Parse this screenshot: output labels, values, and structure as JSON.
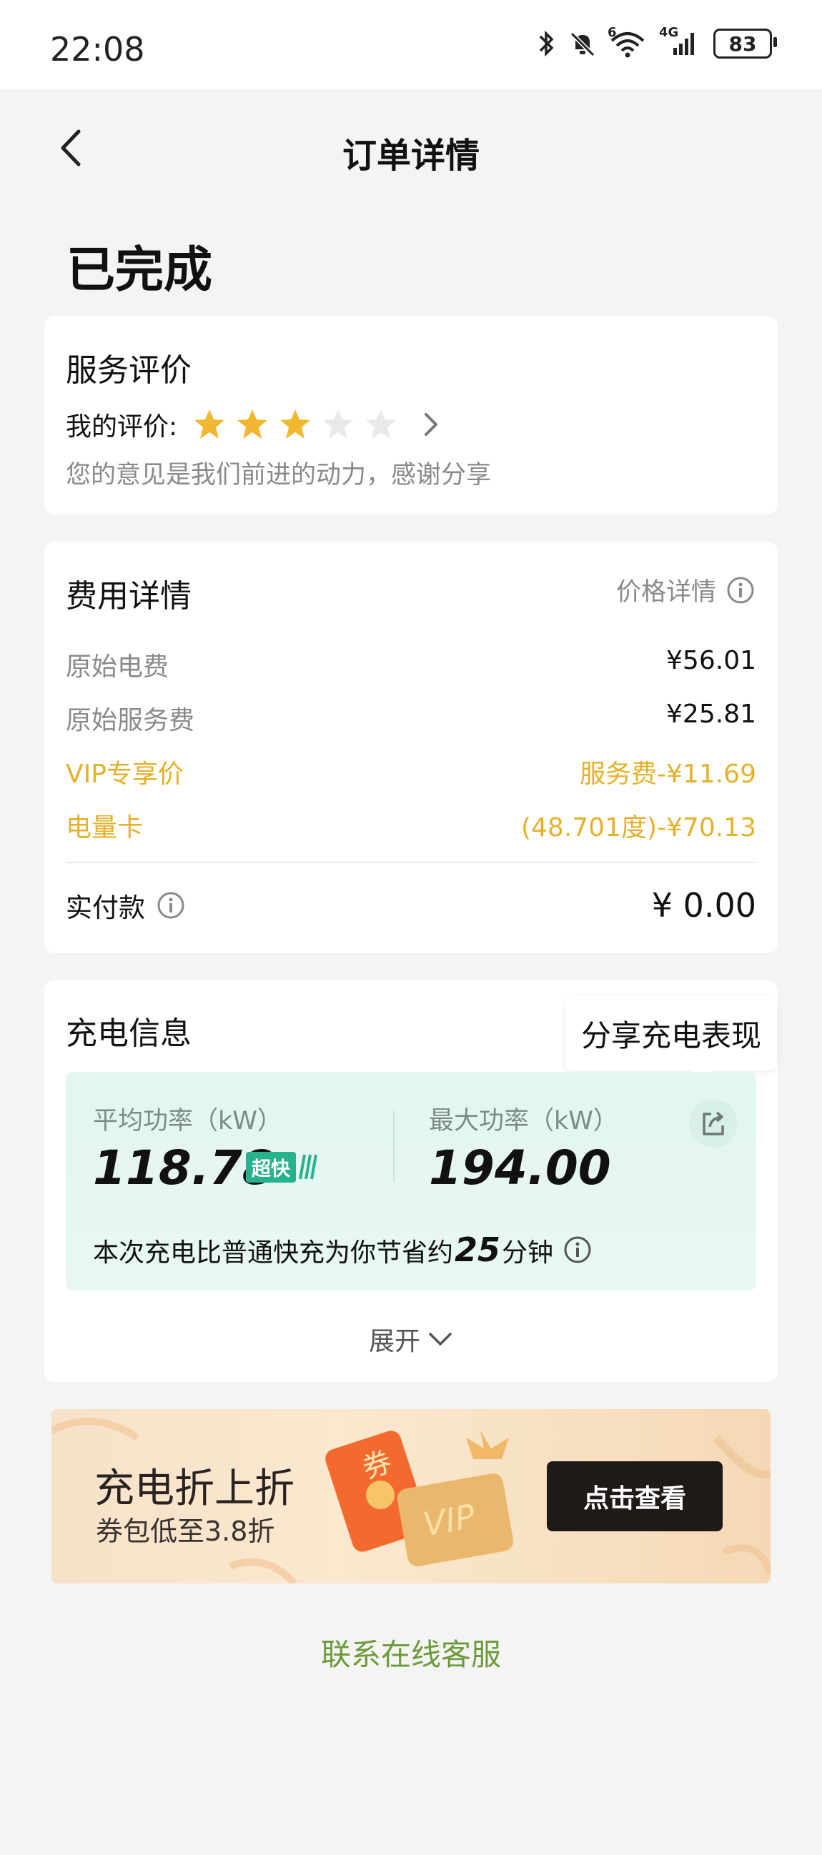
{
  "status_bar": {
    "time": "22:08",
    "battery": "83",
    "network": "4G",
    "wifi_badge": "6"
  },
  "nav": {
    "title": "订单详情"
  },
  "order": {
    "status": "已完成"
  },
  "review": {
    "title": "服务评价",
    "label": "我的评价:",
    "rating": 3,
    "max_rating": 5,
    "hint": "您的意见是我们前进的动力，感谢分享"
  },
  "fees": {
    "title": "费用详情",
    "price_detail_label": "价格详情",
    "rows": [
      {
        "label": "原始电费",
        "value": "¥56.01",
        "highlight": false
      },
      {
        "label": "原始服务费",
        "value": "¥25.81",
        "highlight": false
      },
      {
        "label": "VIP专享价",
        "value": "服务费-¥11.69",
        "highlight": true
      },
      {
        "label": "电量卡",
        "value": "(48.701度)-¥70.13",
        "highlight": true
      }
    ],
    "paid_label": "实付款",
    "paid_value": "¥ 0.00",
    "highlight_color": "#e6b12a"
  },
  "charging": {
    "title": "充电信息",
    "share_tooltip": "分享充电表现",
    "avg_power_label": "平均功率（kW）",
    "avg_power_value": "118.78",
    "fast_badge": "超快",
    "max_power_label": "最大功率（kW）",
    "max_power_value": "194.00",
    "saving_prefix": "本次充电比普通快充为你节省约",
    "saving_minutes": "25",
    "saving_suffix": "分钟",
    "expand_label": "展开"
  },
  "banner": {
    "title": "充电折上折",
    "subtitle": "券包低至3.8折",
    "button_label": "点击查看",
    "coupon_text": "券",
    "vip_text": "VIP"
  },
  "contact": {
    "label": "联系在线客服"
  },
  "colors": {
    "accent_green": "#6e9b3a",
    "star_gold": "#f2b731",
    "badge_green": "#26b28c"
  }
}
